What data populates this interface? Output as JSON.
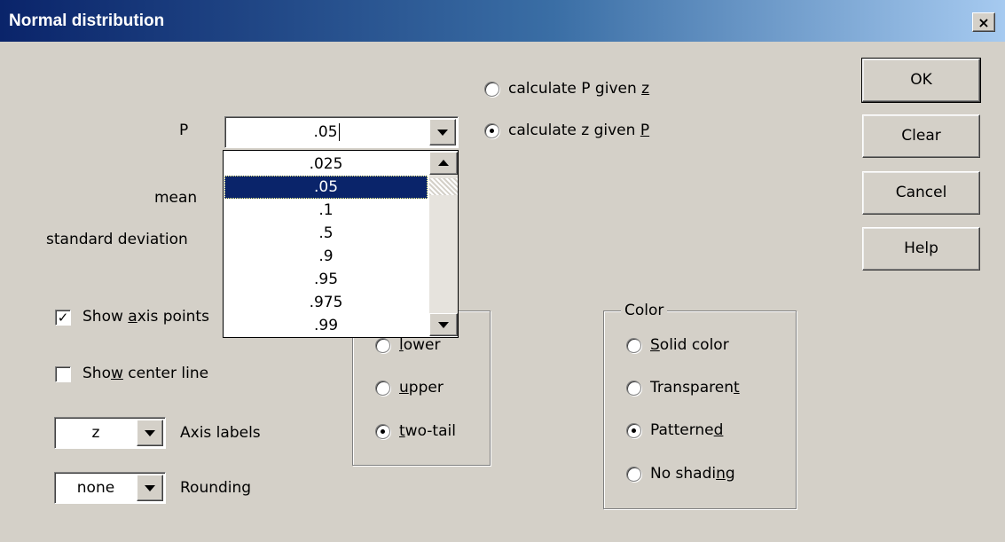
{
  "window": {
    "title": "Normal distribution",
    "close_label": "×"
  },
  "buttons": {
    "ok": "OK",
    "clear": "Clear",
    "cancel": "Cancel",
    "help": "Help"
  },
  "mode": {
    "option_p_given_z": {
      "before": "calculate P given ",
      "key": "z",
      "after": ""
    },
    "option_z_given_p": {
      "before": "calculate z given ",
      "key": "P",
      "after": ""
    },
    "selected": "calculate z given P"
  },
  "fields": {
    "p_label": "P",
    "p_value": ".05",
    "mean_label": "mean",
    "sd_label": "standard deviation"
  },
  "dropdown": {
    "options": [
      ".025",
      ".05",
      ".1",
      ".5",
      ".9",
      ".95",
      ".975",
      ".99"
    ],
    "selected": ".05"
  },
  "checks": {
    "axis_points": {
      "before": "Show ",
      "key": "a",
      "after": "xis points",
      "checked": true
    },
    "center_line": {
      "before": "Sho",
      "key": "w",
      "after": " center line",
      "checked": false
    }
  },
  "selects": {
    "axis_labels": {
      "value": "z",
      "label": "Axis labels"
    },
    "rounding": {
      "value": "none",
      "label": "Rounding"
    }
  },
  "tail": {
    "lower": {
      "before": "",
      "key": "l",
      "after": "ower"
    },
    "upper": {
      "before": "",
      "key": "u",
      "after": "pper"
    },
    "two_tail": {
      "before": "",
      "key": "t",
      "after": "wo-tail"
    },
    "selected": "two-tail"
  },
  "color": {
    "title": "Color",
    "solid": {
      "before": "",
      "key": "S",
      "after": "olid color"
    },
    "transparent": {
      "before": "Transparen",
      "key": "t",
      "after": ""
    },
    "patterned": {
      "before": "Patterne",
      "key": "d",
      "after": ""
    },
    "no_shading": {
      "before": "No shadi",
      "key": "n",
      "after": "g"
    },
    "selected": "Patterned"
  }
}
